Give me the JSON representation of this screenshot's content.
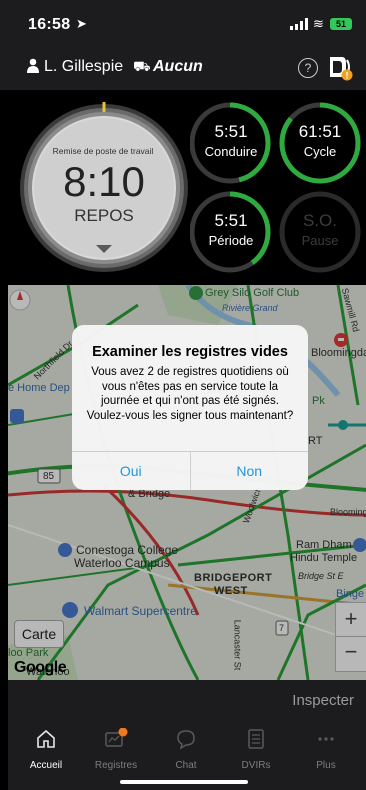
{
  "status_bar": {
    "time": "16:58",
    "battery": "51"
  },
  "header": {
    "driver": "L. Gillespie",
    "vehicle": "Aucun"
  },
  "dashboard": {
    "main": {
      "title": "Remise de poste de travail",
      "time": "8:10",
      "status": "REPOS"
    },
    "rings": [
      {
        "id": "conduire",
        "time": "5:51",
        "label": "Conduire",
        "progress": 0.46
      },
      {
        "id": "cycle",
        "time": "61:51",
        "label": "Cycle",
        "progress": 0.86
      },
      {
        "id": "periode",
        "time": "5:51",
        "label": "Période",
        "progress": 0.4
      },
      {
        "id": "pause",
        "time": "S.O.",
        "label": "Pause",
        "progress": 0
      }
    ],
    "accent": "#2eaa3f"
  },
  "map": {
    "labels": {
      "golf": "Grey Silo Golf Club",
      "riviere": "Rivière Grand",
      "northfield": "Northfield Dr",
      "home_depot": "e Home Dep",
      "bloomingdale": "Bloomingda",
      "pk": "Pk",
      "rt": "RT",
      "bridge": "& Bridge",
      "route85": "85",
      "conestoga": "Conestoga College",
      "waterloo_campus": "Waterloo Campus",
      "bridgeport": "BRIDGEPORT",
      "west": "WEST",
      "ram_dham": "Ram Dham",
      "hindu_temple": "Hindu Temple",
      "bridge_st": "Bridge St E",
      "bingemans": "Binge",
      "walmart": "Walmart Supercentre",
      "loo_park": "loo Park",
      "waterloo": "Waterloo",
      "route7": "7",
      "lancaster": "Lancaster St",
      "sawmill": "Sawmill Rd",
      "blooming_rd": "Blooming",
      "woolwich": "Woolwich"
    },
    "carte_label": "Carte",
    "zoom_in": "+",
    "zoom_out": "−",
    "google": "Google"
  },
  "dialog": {
    "title": "Examiner les registres vides",
    "message": "Vous avez 2 de registres quotidiens où vous n'êtes pas en service toute la journée et qui n'ont pas été signés. Voulez-vous les signer tous maintenant?",
    "yes": "Oui",
    "no": "Non"
  },
  "inspect_label": "Inspecter",
  "tabs": [
    {
      "label": "Accueil",
      "icon": "home-icon",
      "active": true
    },
    {
      "label": "Registres",
      "icon": "logs-icon",
      "active": false
    },
    {
      "label": "Chat",
      "icon": "chat-icon",
      "active": false
    },
    {
      "label": "DVIRs",
      "icon": "dvir-icon",
      "active": false
    },
    {
      "label": "Plus",
      "icon": "more-icon",
      "active": false
    }
  ]
}
